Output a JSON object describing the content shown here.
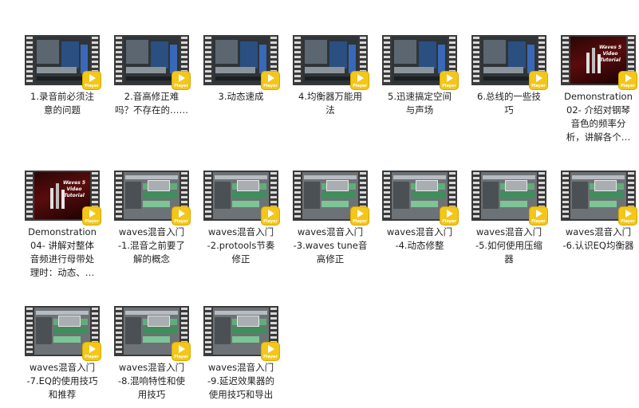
{
  "badge_text": "Player",
  "waves_cover_text": "Waves 5 Video Tutorial",
  "files": [
    {
      "name": "1.录音前必须注意的问题",
      "line1": "1.录音前必须注",
      "line2": "意的问题",
      "line3": "",
      "line4": "",
      "thumb": "daw"
    },
    {
      "name": "2.音高修正难吗？不存在的……",
      "line1": "2.音高修正难",
      "line2": "吗？不存在的……",
      "line3": "",
      "line4": "",
      "thumb": "daw"
    },
    {
      "name": "3.动态速成",
      "line1": "3.动态速成",
      "line2": "",
      "line3": "",
      "line4": "",
      "thumb": "daw"
    },
    {
      "name": "4.均衡器万能用法",
      "line1": "4.均衡器万能用",
      "line2": "法",
      "line3": "",
      "line4": "",
      "thumb": "daw"
    },
    {
      "name": "5.迅速搞定空间与声场",
      "line1": "5.迅速搞定空间",
      "line2": "与声场",
      "line3": "",
      "line4": "",
      "thumb": "daw"
    },
    {
      "name": "6.总线的一些技巧",
      "line1": "6.总线的一些技",
      "line2": "巧",
      "line3": "",
      "line4": "",
      "thumb": "daw"
    },
    {
      "name": "Demonstration 02- 介绍对钢琴音色的频率分析，讲解各个…",
      "line1": "Demonstration",
      "line2": "02- 介绍对钢琴",
      "line3": "音色的频率分",
      "line4": "析，讲解各个…",
      "thumb": "waves"
    },
    {
      "name": "Demonstration 04- 讲解对整体音频进行母带处理时：动态、…",
      "line1": "Demonstration",
      "line2": "04- 讲解对整体",
      "line3": "音频进行母带处",
      "line4": "理时：动态、…",
      "thumb": "waves"
    },
    {
      "name": "waves混音入门-1.混音之前要了解的概念",
      "line1": "waves混音入门",
      "line2": "-1.混音之前要了",
      "line3": "解的概念",
      "line4": "",
      "thumb": "pt"
    },
    {
      "name": "waves混音入门-2.protools节奏修正",
      "line1": "waves混音入门",
      "line2": "-2.protools节奏",
      "line3": "修正",
      "line4": "",
      "thumb": "pt"
    },
    {
      "name": "waves混音入门-3.waves tune音高修正",
      "line1": "waves混音入门",
      "line2": "-3.waves tune音",
      "line3": "高修正",
      "line4": "",
      "thumb": "pt"
    },
    {
      "name": "waves混音入门-4.动态修整",
      "line1": "waves混音入门",
      "line2": "-4.动态修整",
      "line3": "",
      "line4": "",
      "thumb": "pt"
    },
    {
      "name": "waves混音入门-5.如何使用压缩器",
      "line1": "waves混音入门",
      "line2": "-5.如何使用压缩",
      "line3": "器",
      "line4": "",
      "thumb": "pt"
    },
    {
      "name": "waves混音入门-6.认识EQ均衡器",
      "line1": "waves混音入门",
      "line2": "-6.认识EQ均衡器",
      "line3": "",
      "line4": "",
      "thumb": "pt"
    },
    {
      "name": "waves混音入门-7.EQ的使用技巧和推荐",
      "line1": "waves混音入门",
      "line2": "-7.EQ的使用技巧",
      "line3": "和推荐",
      "line4": "",
      "thumb": "pt"
    },
    {
      "name": "waves混音入门-8.混响特性和使用技巧",
      "line1": "waves混音入门",
      "line2": "-8.混响特性和使",
      "line3": "用技巧",
      "line4": "",
      "thumb": "pt"
    },
    {
      "name": "waves混音入门-9.延迟效果器的使用技巧和导出",
      "line1": "waves混音入门",
      "line2": "-9.延迟效果器的",
      "line3": "使用技巧和导出",
      "line4": "",
      "thumb": "pt"
    }
  ]
}
